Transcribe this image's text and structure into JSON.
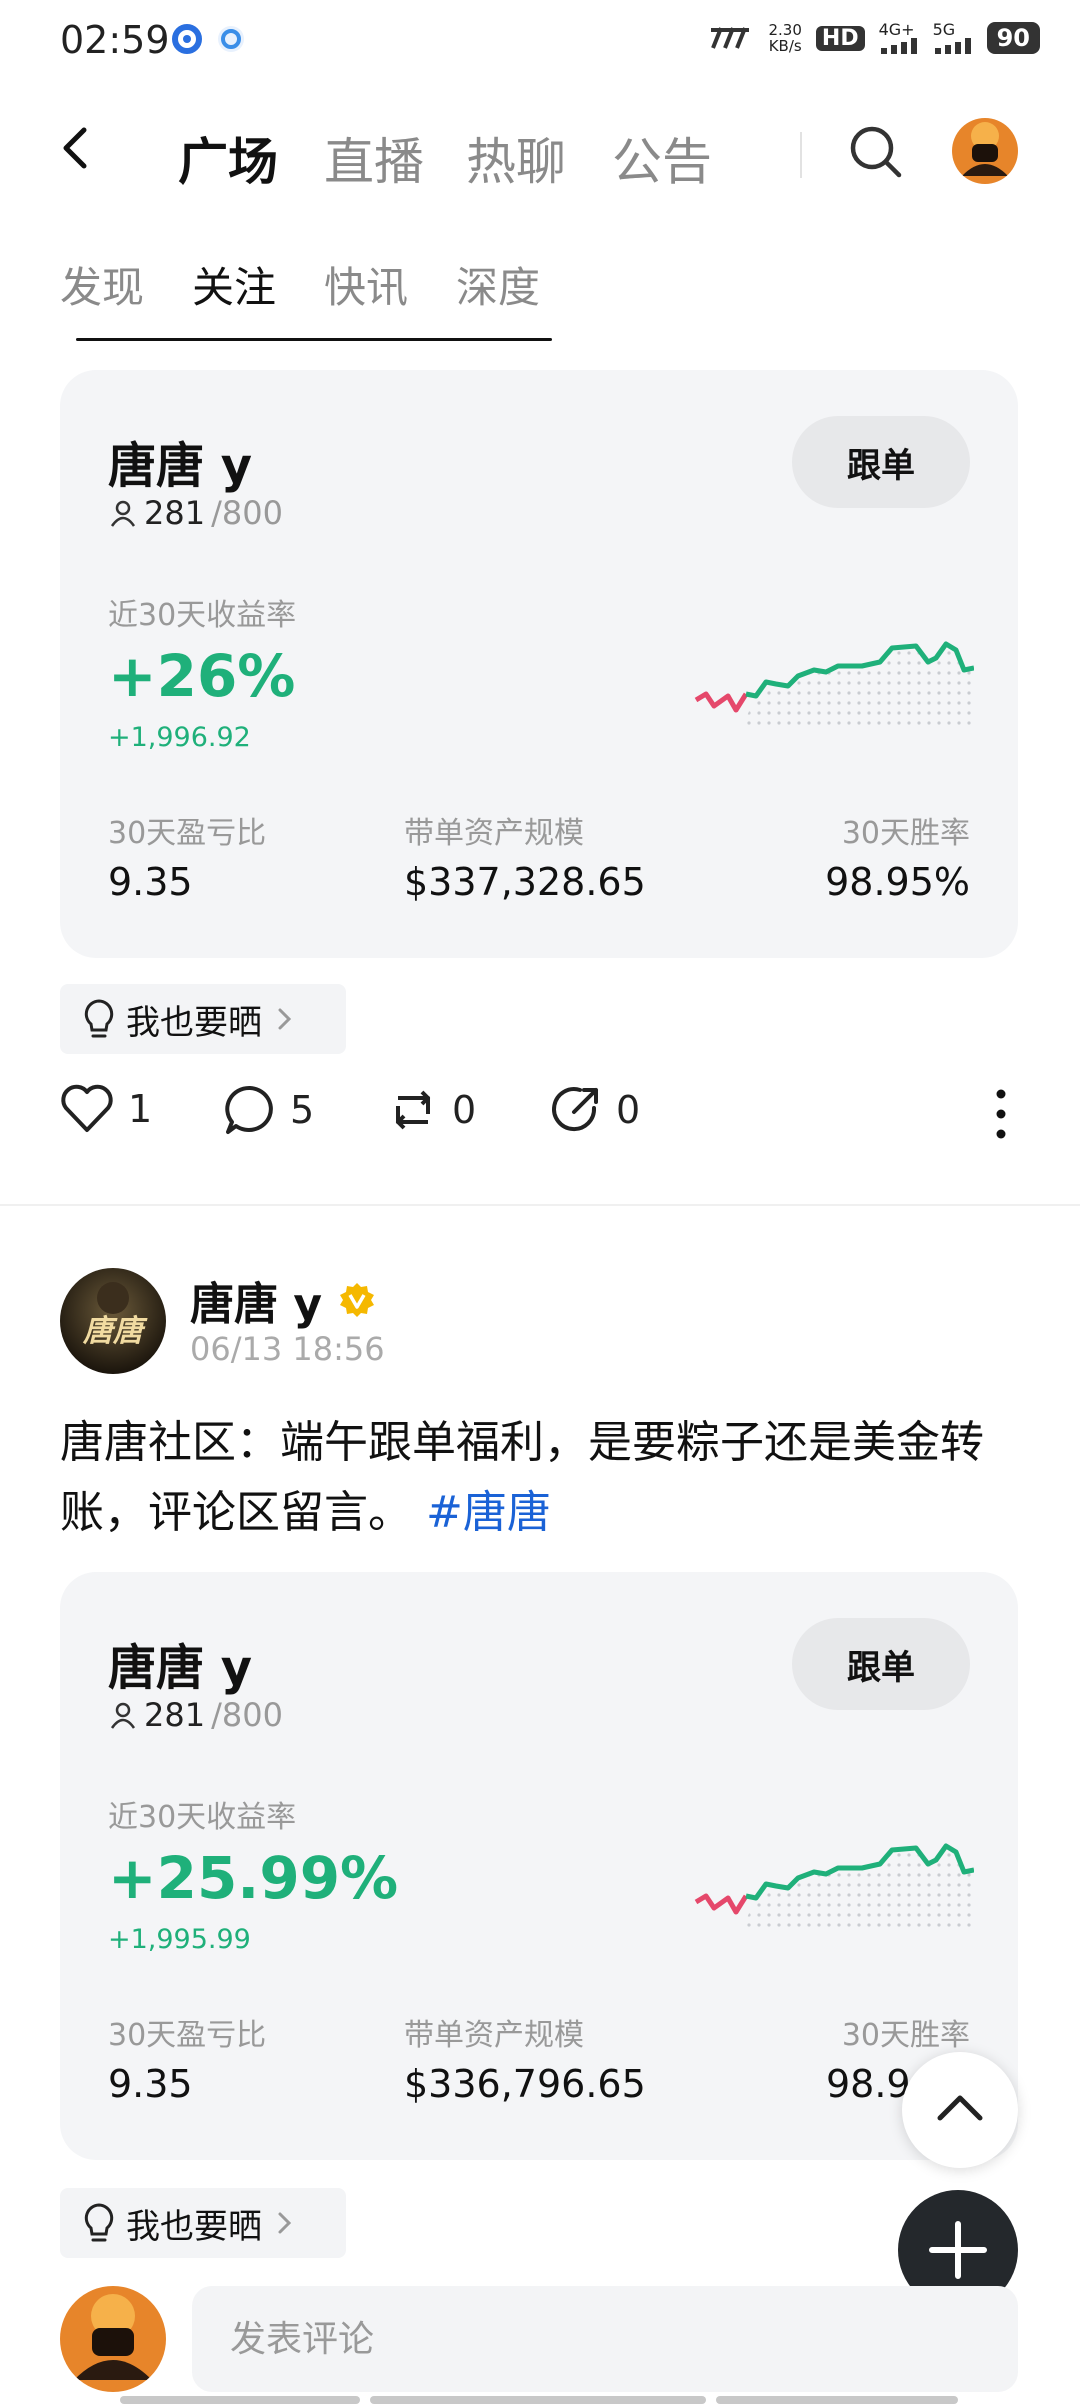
{
  "status_bar": {
    "time": "02:59",
    "speed_value": "2.30",
    "speed_unit": "KB/s",
    "hd": "HD",
    "net1": "4G+",
    "net2": "5G",
    "battery": "90"
  },
  "nav": {
    "tabs": [
      "广场",
      "直播",
      "热聊",
      "公告"
    ],
    "active_tab": "广场"
  },
  "sub_nav": {
    "tabs": [
      "发现",
      "关注",
      "快讯",
      "深度"
    ],
    "active_tab": "关注"
  },
  "cards": [
    {
      "name": "唐唐 y",
      "followers": "281",
      "followers_max": "/800",
      "button": "跟单",
      "return_label": "近30天收益率",
      "return_pct": "+26%",
      "return_amount": "+1,996.92",
      "stats": [
        {
          "label": "30天盈亏比",
          "value": "9.35"
        },
        {
          "label": "带单资产规模",
          "value": "$337,328.65"
        },
        {
          "label": "30天胜率",
          "value": "98.95%"
        }
      ]
    },
    {
      "name": "唐唐 y",
      "followers": "281",
      "followers_max": "/800",
      "button": "跟单",
      "return_label": "近30天收益率",
      "return_pct": "+25.99%",
      "return_amount": "+1,995.99",
      "stats": [
        {
          "label": "30天盈亏比",
          "value": "9.35"
        },
        {
          "label": "带单资产规模",
          "value": "$336,796.65"
        },
        {
          "label": "30天胜率",
          "value": "98.9"
        }
      ]
    }
  ],
  "share_chip": "我也要晒",
  "actions": {
    "likes": "1",
    "comments": "5",
    "reposts": "0",
    "shares": "0"
  },
  "post": {
    "author": "唐唐 y",
    "avatar_text": "唐唐",
    "time": "06/13 18:56",
    "text_line1": "唐唐社区：端午跟单福利，是要粽子还是美金转",
    "text_line2": "账，评论区留言。",
    "hashtag": "#唐唐"
  },
  "comment": {
    "placeholder": "发表评论"
  },
  "colors": {
    "green": "#1fb07a",
    "red": "#e5486b",
    "link": "#1a62d6",
    "verified": "#f5b800"
  }
}
